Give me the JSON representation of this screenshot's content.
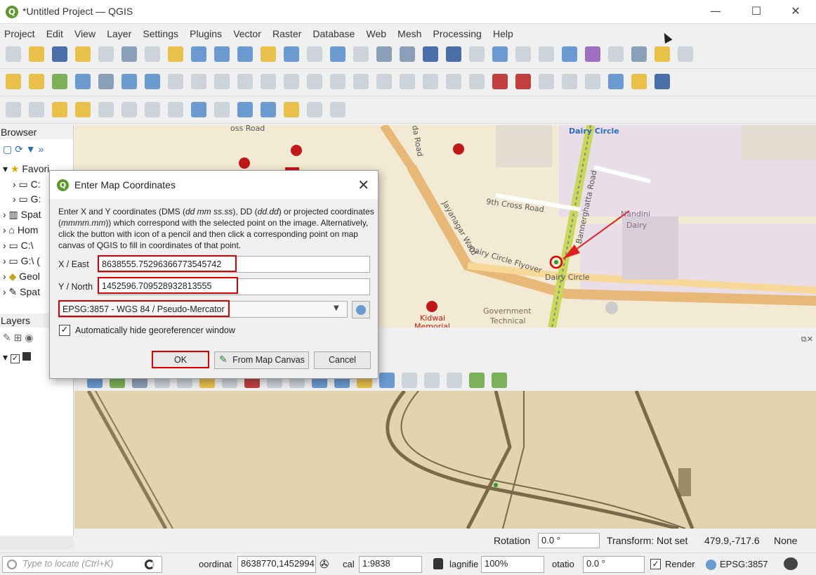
{
  "window": {
    "title": "*Untitled Project — QGIS",
    "minimize": "—",
    "maximize": "☐",
    "close": "✕"
  },
  "menu": [
    "Project",
    "Edit",
    "View",
    "Layer",
    "Settings",
    "Plugins",
    "Vector",
    "Raster",
    "Database",
    "Web",
    "Mesh",
    "Processing",
    "Help"
  ],
  "browser": {
    "title": "Browser",
    "items": [
      "Favori",
      "C:",
      "G:",
      "Spat",
      "Hom",
      "C:\\",
      "G:\\ (",
      "Geol",
      "Spat"
    ]
  },
  "layers": {
    "title": "Layers"
  },
  "map": {
    "labels": [
      "Dairy Circle",
      "9th Cross Road",
      "Jayanagar Ward",
      "Dairy Circle Flyover",
      "Dairy Circle",
      "Nandini",
      "Dairy",
      "Government",
      "Technical",
      "Kidwai",
      "Memorial",
      "Bannerghatta Road",
      "oss Road",
      "da Road"
    ]
  },
  "dialog": {
    "title": "Enter Map Coordinates",
    "description_parts": [
      "Enter X and Y coordinates (DMS (",
      "dd mm ss.ss",
      "), DD (",
      "dd.dd",
      ") or projected coordinates (",
      "mmmm.mm",
      ")) which correspond with the selected point on the image. Alternatively, click the button with icon of a pencil and then click a corresponding point on map canvas of QGIS to fill in coordinates of that point."
    ],
    "x_label": "X / East",
    "x_value": "8638555.75296366773545742",
    "y_label": "Y / North",
    "y_value": "1452596.709528932813555",
    "crs": "EPSG:3857 - WGS 84 / Pseudo-Mercator",
    "autohide_label": "Automatically hide georeferencer window",
    "ok": "OK",
    "from_canvas": "From Map Canvas",
    "cancel": "Cancel"
  },
  "georef_status": {
    "rotation_label": "Rotation",
    "rotation_value": "0.0 °",
    "transform": "Transform: Not set",
    "coords": "479.9,-717.6",
    "none": "None"
  },
  "statusbar": {
    "locate_placeholder": "Type to locate (Ctrl+K)",
    "coordinate_label": "oordinat",
    "coordinate_value": "8638770,1452994",
    "scale_label": "cal",
    "scale_value": "1:9838",
    "magnifier_label": "lagnifie",
    "magnifier_value": "100%",
    "rotation_label": "otatio",
    "rotation_value": "0.0 °",
    "render_label": "Render",
    "crs": "EPSG:3857"
  }
}
